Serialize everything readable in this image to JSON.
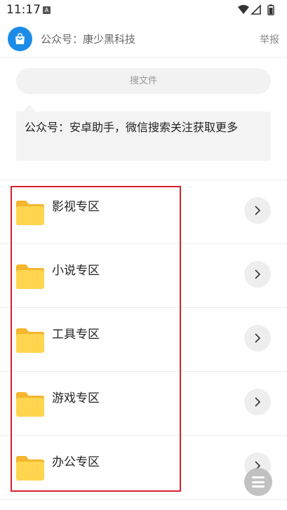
{
  "status_bar": {
    "time": "11:17",
    "notification_badge": "A",
    "icons": [
      "wifi-icon",
      "signal-icon",
      "battery-icon"
    ]
  },
  "header": {
    "title": "公众号：康少黑科技",
    "report_label": "举报",
    "logo_icon": "shopping-bag-icon"
  },
  "search": {
    "placeholder": "搜文件"
  },
  "notice": {
    "text": "公众号：安卓助手，微信搜索关注获取更多"
  },
  "folders": [
    {
      "label": "影视专区"
    },
    {
      "label": "小说专区"
    },
    {
      "label": "工具专区"
    },
    {
      "label": "游戏专区"
    },
    {
      "label": "办公专区"
    }
  ],
  "colors": {
    "accent": "#1a8ce8",
    "folder": "#ffd54f",
    "folder_tab": "#f5b52e",
    "highlight": "#d5202a"
  }
}
